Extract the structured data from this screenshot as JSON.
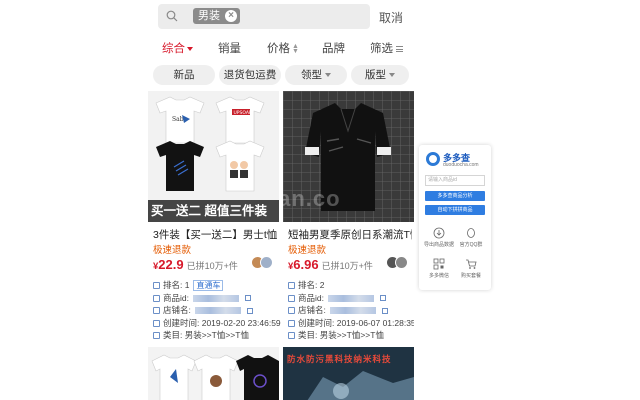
{
  "search": {
    "chip_label": "男装",
    "chip_close": "×",
    "cancel_label": "取消"
  },
  "sort_tabs": [
    {
      "label": "综合"
    },
    {
      "label": "销量"
    },
    {
      "label": "价格"
    },
    {
      "label": "品牌"
    },
    {
      "label": "筛选"
    }
  ],
  "filters": [
    {
      "label": "新品"
    },
    {
      "label": "退货包运费"
    },
    {
      "label": "领型"
    },
    {
      "label": "版型"
    }
  ],
  "products": [
    {
      "banner": "买一送二  超值三件装",
      "title": "3件装【买一送二】男士t恤男",
      "tag": "极速退款",
      "price_symbol": "¥",
      "price": "22.9",
      "sold": "已拼10万+件",
      "rank_label": "排名: 1",
      "rank_btn": "直通车",
      "goods_id_label": "商品id: ",
      "shop_label": "店铺名: ",
      "created": "创建时间: 2019-02-20 23:46:59",
      "category": "类目: 男装>>T恤>>T恤"
    },
    {
      "title": "短袖男夏季原创日系潮流T恤",
      "tag": "极速退款",
      "price_symbol": "¥",
      "price": "6.96",
      "sold": "已拼10万+件",
      "rank_label": "排名: 2",
      "goods_id_label": "商品id: ",
      "shop_label": "店铺名: ",
      "created": "创建时间: 2019-06-07 01:28:35",
      "category": "类目: 男装>>T恤>>T恤"
    }
  ],
  "second_row_text": "防水防污黑科技纳米科技",
  "tshirt_print": "UPSOAR",
  "watermark": "chajian.co",
  "plugin": {
    "logo_name": "多多查",
    "logo_sub": "duoduocha.com",
    "login_placeholder": "请输入商品id",
    "btn_analyze": "多多查商品分析",
    "btn_auto": "自动下拼拼商品",
    "tools": [
      {
        "label": "导出商品数据"
      },
      {
        "label": "官方QQ群"
      },
      {
        "label": "多多微信"
      },
      {
        "label": "购买套餐"
      }
    ]
  },
  "colors": {
    "accent": "#d7182a",
    "orange": "#e45a00",
    "plugin_blue": "#2f7de1"
  }
}
